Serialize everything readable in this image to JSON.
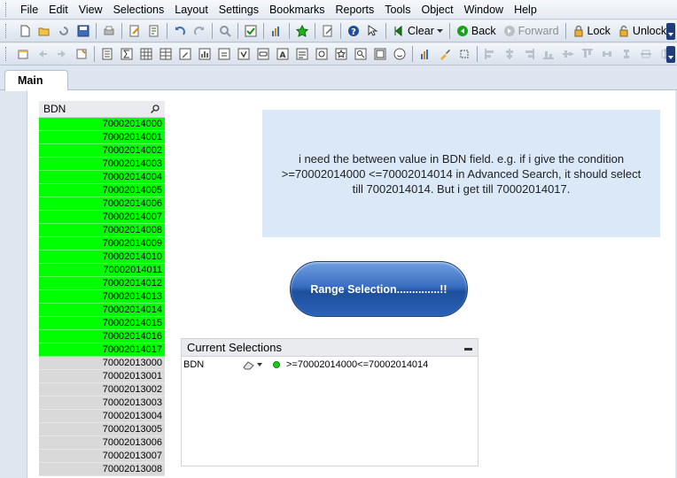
{
  "menubar": {
    "items": [
      "File",
      "Edit",
      "View",
      "Selections",
      "Layout",
      "Settings",
      "Bookmarks",
      "Reports",
      "Tools",
      "Object",
      "Window",
      "Help"
    ]
  },
  "toolbar": {
    "clear_label": "Clear",
    "back_label": "Back",
    "forward_label": "Forward",
    "lock_label": "Lock",
    "unlock_label": "Unlock"
  },
  "tabs": {
    "main_label": "Main"
  },
  "listbox": {
    "title": "BDN",
    "rows": [
      {
        "value": "70002014000",
        "state": "selected"
      },
      {
        "value": "70002014001",
        "state": "selected"
      },
      {
        "value": "70002014002",
        "state": "selected"
      },
      {
        "value": "70002014003",
        "state": "selected"
      },
      {
        "value": "70002014004",
        "state": "selected"
      },
      {
        "value": "70002014005",
        "state": "selected"
      },
      {
        "value": "70002014006",
        "state": "selected"
      },
      {
        "value": "70002014007",
        "state": "selected"
      },
      {
        "value": "70002014008",
        "state": "selected"
      },
      {
        "value": "70002014009",
        "state": "selected"
      },
      {
        "value": "70002014010",
        "state": "selected"
      },
      {
        "value": "70002014011",
        "state": "selected"
      },
      {
        "value": "70002014012",
        "state": "selected"
      },
      {
        "value": "70002014013",
        "state": "selected"
      },
      {
        "value": "70002014014",
        "state": "selected"
      },
      {
        "value": "70002014015",
        "state": "selected"
      },
      {
        "value": "70002014016",
        "state": "selected"
      },
      {
        "value": "70002014017",
        "state": "selected"
      },
      {
        "value": "70002013000",
        "state": "excluded"
      },
      {
        "value": "70002013001",
        "state": "excluded"
      },
      {
        "value": "70002013002",
        "state": "excluded"
      },
      {
        "value": "70002013003",
        "state": "excluded"
      },
      {
        "value": "70002013004",
        "state": "excluded"
      },
      {
        "value": "70002013005",
        "state": "excluded"
      },
      {
        "value": "70002013006",
        "state": "excluded"
      },
      {
        "value": "70002013007",
        "state": "excluded"
      },
      {
        "value": "70002013008",
        "state": "excluded"
      }
    ]
  },
  "textbox": {
    "text": "i need the between value in BDN field. e.g. if i give the condition >=70002014000 <=70002014014 in Advanced Search, it should select till 7002014014. But i get till 70002014017."
  },
  "button": {
    "label": "Range Selection..............!!"
  },
  "current_selections": {
    "title": "Current Selections",
    "field": "BDN",
    "value": ">=70002014000<=70002014014"
  },
  "colors": {
    "selected": "#00ff00",
    "excluded": "#d9d9d9",
    "textbox_bg": "#dae8f7",
    "button": "#2b62b8"
  }
}
